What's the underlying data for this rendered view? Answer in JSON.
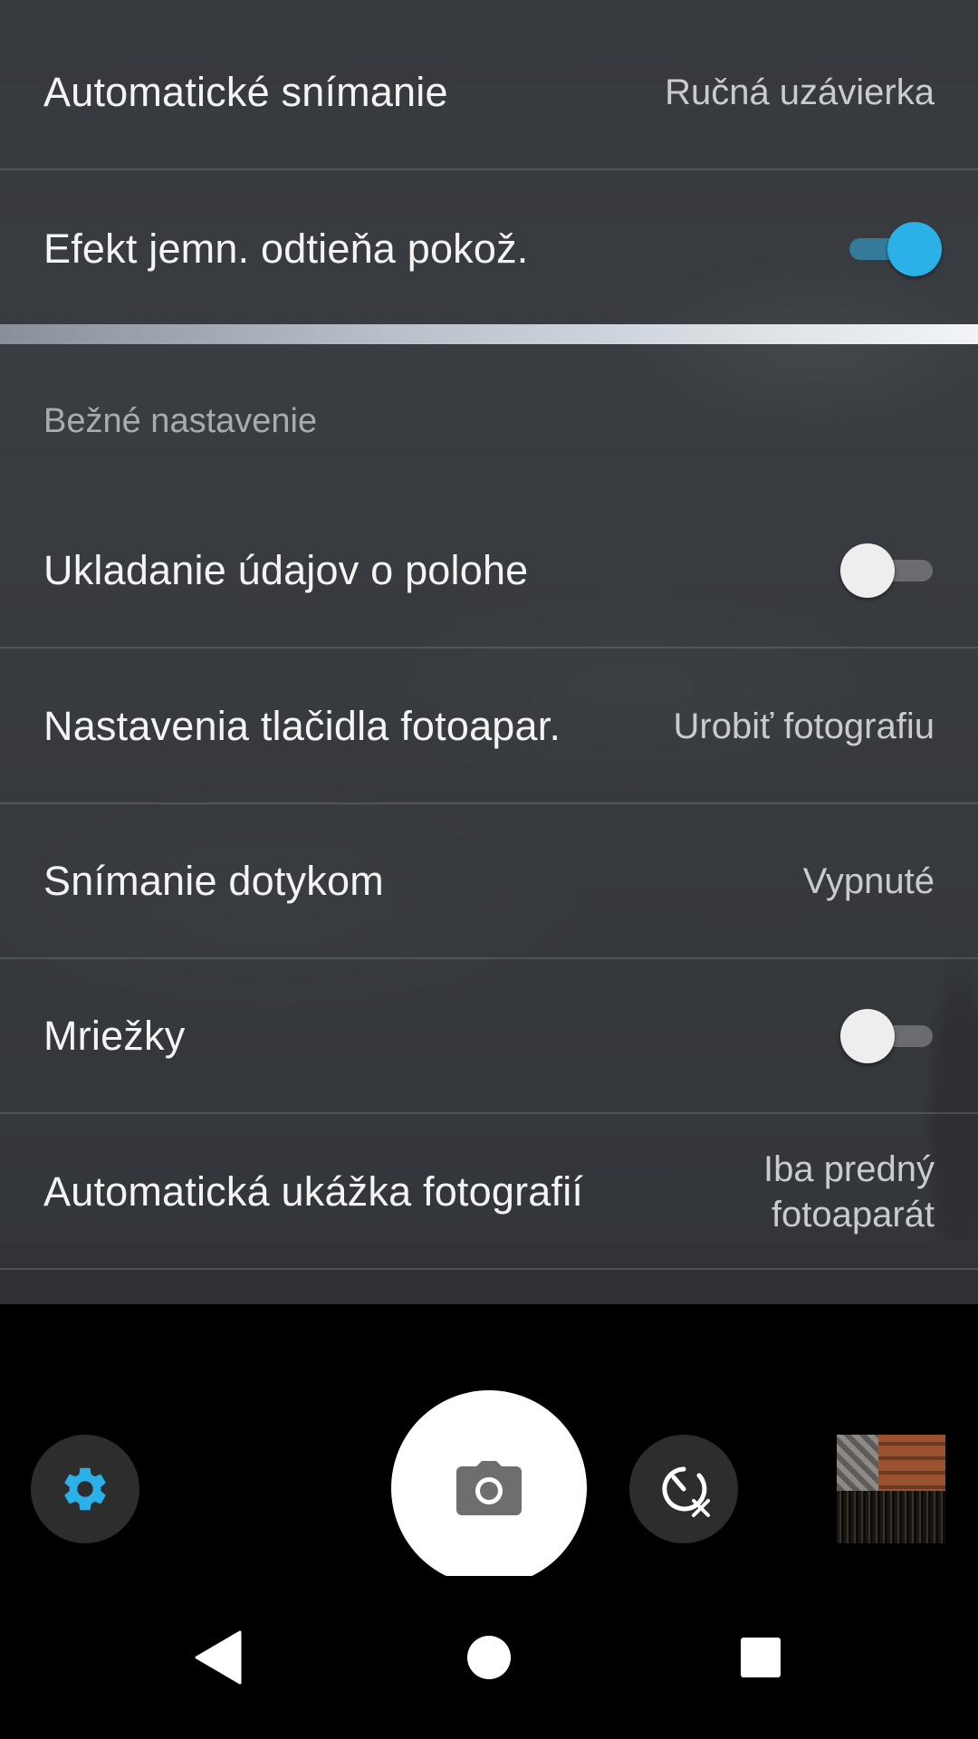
{
  "settings_top": {
    "auto_capture": {
      "label": "Automatické snímanie",
      "value": "Ručná uzávierka"
    },
    "skin_softening": {
      "label": "Efekt jemn. odtieňa pokož.",
      "enabled": true
    }
  },
  "common_section": {
    "header": "Bežné nastavenie",
    "location": {
      "label": "Ukladanie údajov o polohe",
      "enabled": false
    },
    "camera_key": {
      "label": "Nastavenia tlačidla fotoapar.",
      "value": "Urobiť fotografiu"
    },
    "touch_capture": {
      "label": "Snímanie dotykom",
      "value": "Vypnuté"
    },
    "grid_lines": {
      "label": "Mriežky",
      "enabled": false
    },
    "auto_review": {
      "label": "Automatická ukážka fotografií",
      "value_line1": "Iba predný",
      "value_line2": "fotoaparát"
    }
  },
  "camera_bar": {
    "settings_icon": "gear-icon",
    "shutter_icon": "camera-icon",
    "timer_icon": "timer-off-icon",
    "accent_color": "#2bb1e8"
  },
  "nav_bar": {
    "back_icon": "back-triangle-icon",
    "home_icon": "home-circle-icon",
    "recents_icon": "recents-square-icon"
  }
}
